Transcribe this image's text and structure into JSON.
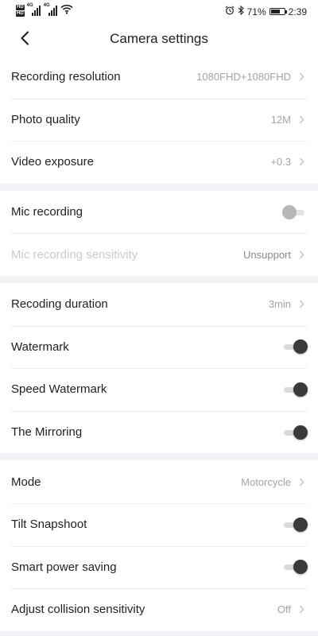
{
  "status_bar": {
    "hd_1": "HD",
    "hd_2": "HD",
    "signal_tag_1": "4G",
    "signal_tag_2": "4G",
    "battery_percent": "71%",
    "battery_level": 0.71,
    "time": "2:39"
  },
  "nav": {
    "title": "Camera settings"
  },
  "group1": {
    "rows": [
      {
        "label": "Recording resolution",
        "value": "1080FHD+1080FHD"
      },
      {
        "label": "Photo quality",
        "value": "12M"
      },
      {
        "label": "Video exposure",
        "value": "+0.3"
      }
    ]
  },
  "group2": {
    "mic_recording": {
      "label": "Mic recording",
      "state": "off"
    },
    "mic_sensitivity": {
      "label": "Mic recording sensitivity",
      "value": "Unsupport"
    }
  },
  "group3": {
    "duration": {
      "label": "Recoding duration",
      "value": "3min"
    },
    "watermark": {
      "label": "Watermark",
      "state": "on"
    },
    "speed_watermark": {
      "label": "Speed Watermark",
      "state": "on"
    },
    "mirroring": {
      "label": "The Mirroring",
      "state": "on"
    }
  },
  "group4": {
    "mode": {
      "label": "Mode",
      "value": "Motorcycle"
    },
    "tilt_snapshoot": {
      "label": "Tilt Snapshoot",
      "state": "on"
    },
    "smart_power_saving": {
      "label": "Smart power saving",
      "state": "on"
    },
    "collision_sensitivity": {
      "label": "Adjust collision sensitivity",
      "value": "Off"
    }
  },
  "colors": {
    "page_bg": "#f2f2f6",
    "card_bg": "#ffffff",
    "toggle_on_knob": "#3a3a3a",
    "toggle_off_knob": "#b7b7b7",
    "value_text": "#a3a3a3",
    "disabled_text": "#cbcbcb"
  },
  "icons": {
    "back": "back-arrow-icon",
    "chevron": "chevron-right-icon",
    "alarm": "alarm-icon",
    "bluetooth": "bluetooth-icon",
    "wifi": "wifi-icon",
    "signal": "signal-icon",
    "battery": "battery-icon"
  }
}
